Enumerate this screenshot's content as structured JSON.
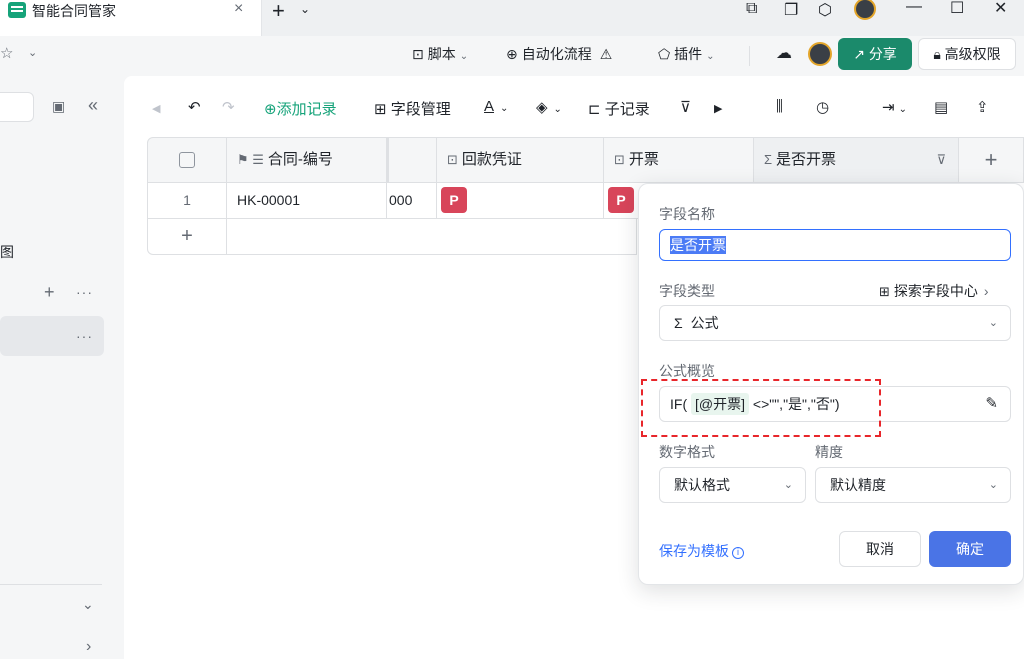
{
  "titlebar": {
    "tab_title": "智能合同管家",
    "close_glyph": "×",
    "newtab_glyph": "+",
    "dropdown_glyph": "⌄",
    "minimize_glyph": "—",
    "maximize_glyph": "☐",
    "close_window_glyph": "✕"
  },
  "topbar": {
    "star_glyph": "☆",
    "star_dd": "⌄",
    "script_label": "脚本",
    "automation_label": "自动化流程",
    "plugin_label": "插件",
    "share_label": "分享",
    "permission_label": "高级权限"
  },
  "sidebar": {
    "collapse_glyph": "«",
    "partial_text": "图",
    "plus_glyph": "+",
    "more_glyph": "···",
    "chevron_down": "⌄",
    "chevron_right": "›"
  },
  "toolbar": {
    "add_record": "添加记录",
    "field_manage": "字段管理",
    "sub_record": "子记录",
    "text_a": "A"
  },
  "grid": {
    "columns": [
      {
        "label": "合同-编号",
        "icon": "⚑ ☰"
      },
      {
        "label": "",
        "icon": ""
      },
      {
        "label": "回款凭证",
        "icon": "⊡"
      },
      {
        "label": "开票",
        "icon": "⊡"
      },
      {
        "label": "是否开票",
        "icon": "Σ"
      }
    ],
    "add_column_glyph": "+",
    "rows": [
      {
        "index": "1",
        "contract_no": "HK-00001",
        "partial_value": "000"
      }
    ],
    "attachment_glyph": "P",
    "add_row_glyph": "+"
  },
  "field_panel": {
    "name_label": "字段名称",
    "name_value": "是否开票",
    "type_label": "字段类型",
    "explore_label": "探索字段中心",
    "type_value": "公式",
    "type_icon": "Σ",
    "formula_label": "公式概览",
    "formula_prefix": "IF(",
    "formula_chip": "[@开票]",
    "formula_rest": "<>\"\",\"是\",\"否\")",
    "number_format_label": "数字格式",
    "number_format_value": "默认格式",
    "precision_label": "精度",
    "precision_value": "默认精度",
    "save_template": "保存为模板",
    "cancel": "取消",
    "confirm": "确定"
  },
  "colors": {
    "share_bg": "#1b8a6b",
    "confirm_bg": "#4a74e6",
    "highlight_border": "#e8262b",
    "attachment_bg": "#d8455a"
  }
}
